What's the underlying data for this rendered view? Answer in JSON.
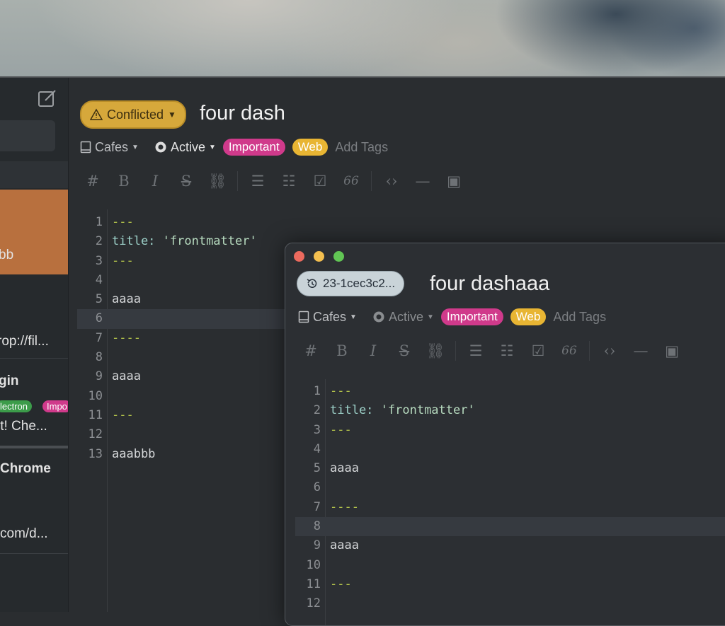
{
  "sidebar": {
    "item1_fragment": "bb",
    "item2_fragment": "rop://fil...",
    "item3_title_fragment": "gin",
    "item3_tag1": "lectron",
    "item3_tag2": "Impo",
    "item3_snippet": "it! Che...",
    "item4_title_fragment": "Chrome",
    "item4_snippet": "com/d..."
  },
  "note": {
    "status_label": "Conflicted",
    "title": "four dash",
    "notebook": "Cafes",
    "state": "Active",
    "tags": [
      "Important",
      "Web"
    ],
    "add_tags": "Add Tags",
    "lines": [
      {
        "num": "1",
        "text": "---"
      },
      {
        "num": "2",
        "text_key": "title:",
        "text_val": " 'frontmatter'"
      },
      {
        "num": "3",
        "text": "---"
      },
      {
        "num": "4",
        "text": ""
      },
      {
        "num": "5",
        "text": "aaaa"
      },
      {
        "num": "6",
        "text": ""
      },
      {
        "num": "7",
        "text": "----"
      },
      {
        "num": "8",
        "text": ""
      },
      {
        "num": "9",
        "text": "aaaa"
      },
      {
        "num": "10",
        "text": ""
      },
      {
        "num": "11",
        "text": "---"
      },
      {
        "num": "12",
        "text": ""
      },
      {
        "num": "13",
        "text": "aaabbb"
      }
    ]
  },
  "window2": {
    "version_label": "23-1cec3c2...",
    "title": "four dashaaa",
    "notebook": "Cafes",
    "state": "Active",
    "tags": [
      "Important",
      "Web"
    ],
    "add_tags": "Add Tags",
    "lines": [
      {
        "num": "1",
        "text": "---"
      },
      {
        "num": "2",
        "text_key": "title:",
        "text_val": " 'frontmatter'"
      },
      {
        "num": "3",
        "text": "---"
      },
      {
        "num": "4",
        "text": ""
      },
      {
        "num": "5",
        "text": "aaaa"
      },
      {
        "num": "6",
        "text": ""
      },
      {
        "num": "7",
        "text": "----"
      },
      {
        "num": "8",
        "text": ""
      },
      {
        "num": "9",
        "text": "aaaa"
      },
      {
        "num": "10",
        "text": ""
      },
      {
        "num": "11",
        "text": "---"
      },
      {
        "num": "12",
        "text": ""
      }
    ]
  },
  "toolbar": {
    "heading": "#",
    "bold": "B",
    "italic": "I",
    "strike": "S",
    "quote": "66"
  },
  "colors": {
    "conflicted": "#d6a83b",
    "important_tag": "#d03a8b",
    "web_tag": "#e8b533",
    "selected_note": "#b8703e"
  }
}
